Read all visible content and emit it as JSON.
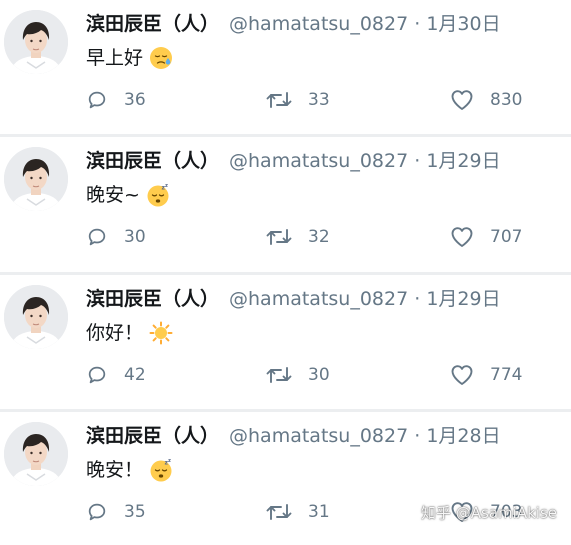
{
  "tweets": [
    {
      "name": "滨田辰臣（人）",
      "handle": "@hamatatsu_0827",
      "date": "· 1月30日",
      "text": "早上好",
      "emoji": "sad-sweat-face",
      "replies": "36",
      "retweets": "33",
      "likes": "830"
    },
    {
      "name": "滨田辰臣（人）",
      "handle": "@hamatatsu_0827",
      "date": "· 1月29日",
      "text": "晚安~",
      "emoji": "sleeping-face",
      "replies": "30",
      "retweets": "32",
      "likes": "707"
    },
    {
      "name": "滨田辰臣（人）",
      "handle": "@hamatatsu_0827",
      "date": "· 1月29日",
      "text": "你好！",
      "emoji": "sun",
      "replies": "42",
      "retweets": "30",
      "likes": "774"
    },
    {
      "name": "滨田辰臣（人）",
      "handle": "@hamatatsu_0827",
      "date": "· 1月28日",
      "text": "晚安！",
      "emoji": "sleeping-face",
      "replies": "35",
      "retweets": "31",
      "likes": "703"
    }
  ],
  "watermark": "知乎 @AsamiAkise",
  "colors": {
    "text": "#14171a",
    "secondary": "#657786",
    "divider": "#eceef0",
    "emoji_yellow": "#ffcc4d"
  }
}
